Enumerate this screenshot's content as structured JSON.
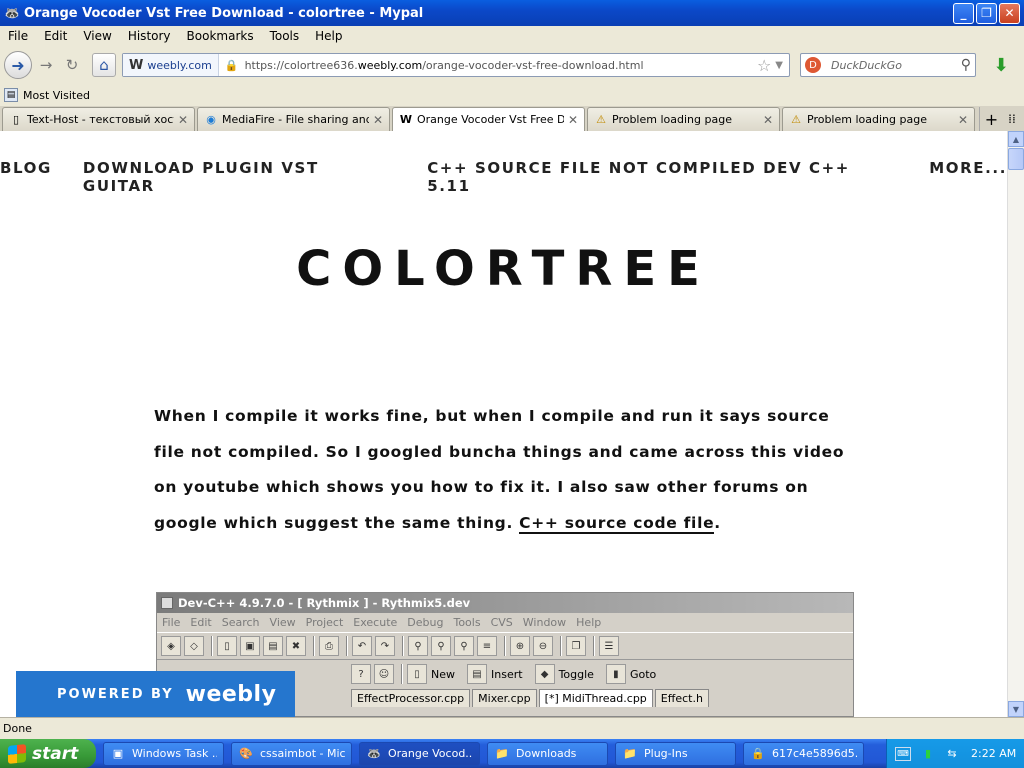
{
  "window": {
    "title": "Orange Vocoder Vst Free Download - colortree - Mypal"
  },
  "menubar": [
    "File",
    "Edit",
    "View",
    "History",
    "Bookmarks",
    "Tools",
    "Help"
  ],
  "navbar": {
    "site_identity": "weebly.com",
    "url_prefix": "https://colortree636.",
    "url_domain": "weebly.com",
    "url_path": "/orange-vocoder-vst-free-download.html",
    "search_placeholder": "DuckDuckGo"
  },
  "bookmarks": {
    "most_visited": "Most Visited"
  },
  "tabs": [
    {
      "label": "Text-Host - текстовый хост...",
      "icon": "document-icon"
    },
    {
      "label": "MediaFire - File sharing and s...",
      "icon": "mediafire-icon"
    },
    {
      "label": "Orange Vocoder Vst Free Do...",
      "icon": "weebly-icon"
    },
    {
      "label": "Problem loading page",
      "icon": "warning-icon"
    },
    {
      "label": "Problem loading page",
      "icon": "warning-icon"
    }
  ],
  "page": {
    "nav": [
      "BLOG",
      "DOWNLOAD PLUGIN VST GUITAR",
      "C++ SOURCE FILE NOT COMPILED DEV C++ 5.11",
      "MORE..."
    ],
    "site_title": "COLORTREE",
    "article_text": "When I compile it works fine, but when I compile and run it says source file not compiled. So I googled buncha things and came across this video on youtube which shows you how to fix it. I also saw other forums on google which suggest the same thing. ",
    "article_link": "C++ source code file",
    "article_end": "."
  },
  "embed": {
    "title": "Dev-C++ 4.9.7.0  -  [ Rythmix ] - Rythmix5.dev",
    "menu": [
      "File",
      "Edit",
      "Search",
      "View",
      "Project",
      "Execute",
      "Debug",
      "Tools",
      "CVS",
      "Window",
      "Help"
    ],
    "toolbar2": [
      "New",
      "Insert",
      "Toggle",
      "Goto"
    ],
    "tabs": [
      "EffectProcessor.cpp",
      "Mixer.cpp",
      "[*] MidiThread.cpp",
      "Effect.h"
    ]
  },
  "weebly_badge": {
    "powered_by": "POWERED BY",
    "brand": "weebly"
  },
  "statusbar": {
    "text": "Done"
  },
  "taskbar": {
    "start": "start",
    "tasks": [
      {
        "label": "Windows Task ...",
        "icon": "task-manager-icon"
      },
      {
        "label": "cssaimbot - Mic...",
        "icon": "paint-icon"
      },
      {
        "label": "Orange Vocod...",
        "icon": "browser-icon"
      },
      {
        "label": "Downloads",
        "icon": "folder-icon"
      },
      {
        "label": "Plug-Ins",
        "icon": "folder-icon"
      },
      {
        "label": "617c4e5896d5...",
        "icon": "lock-icon"
      }
    ],
    "time": "2:22 AM"
  }
}
